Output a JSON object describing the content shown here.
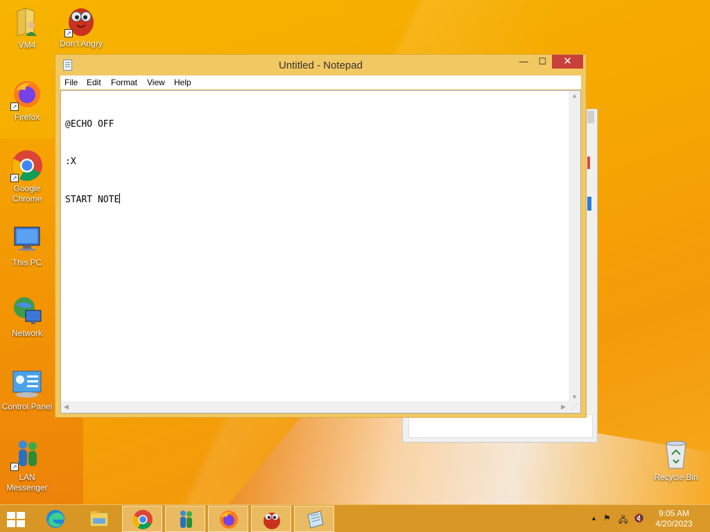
{
  "desktop": {
    "icons": [
      {
        "label": "VM4",
        "icon": "folder-user-icon"
      },
      {
        "label": "Don't Angry",
        "icon": "angry-bird-game-icon"
      },
      {
        "label": "Firefox",
        "icon": "firefox-icon"
      },
      {
        "label": "Google Chrome",
        "icon": "chrome-icon"
      },
      {
        "label": "This PC",
        "icon": "computer-icon"
      },
      {
        "label": "Network",
        "icon": "network-icon"
      },
      {
        "label": "Control Panel",
        "icon": "control-panel-icon"
      },
      {
        "label": "LAN Messenger",
        "icon": "lan-messenger-icon"
      },
      {
        "label": "Recycle Bin",
        "icon": "recycle-bin-icon"
      }
    ]
  },
  "notepad": {
    "title": "Untitled - Notepad",
    "menu": [
      "File",
      "Edit",
      "Format",
      "View",
      "Help"
    ],
    "lines": [
      "@ECHO OFF",
      ":X",
      "START NOTE"
    ],
    "controls": {
      "minimize": "—",
      "maximize": "☐",
      "close": "✕"
    }
  },
  "taskbar": {
    "items": [
      "start-icon",
      "edge-icon",
      "file-explorer-icon",
      "chrome-icon",
      "lan-messenger-icon",
      "firefox-icon",
      "game-icon",
      "notepad-icon"
    ],
    "clock": {
      "time": "9:05 AM",
      "date": "4/20/2023"
    }
  },
  "colors": {
    "wallpaper": "#f6a800",
    "window_frame": "#f2c862",
    "close_button": "#c7403a"
  }
}
